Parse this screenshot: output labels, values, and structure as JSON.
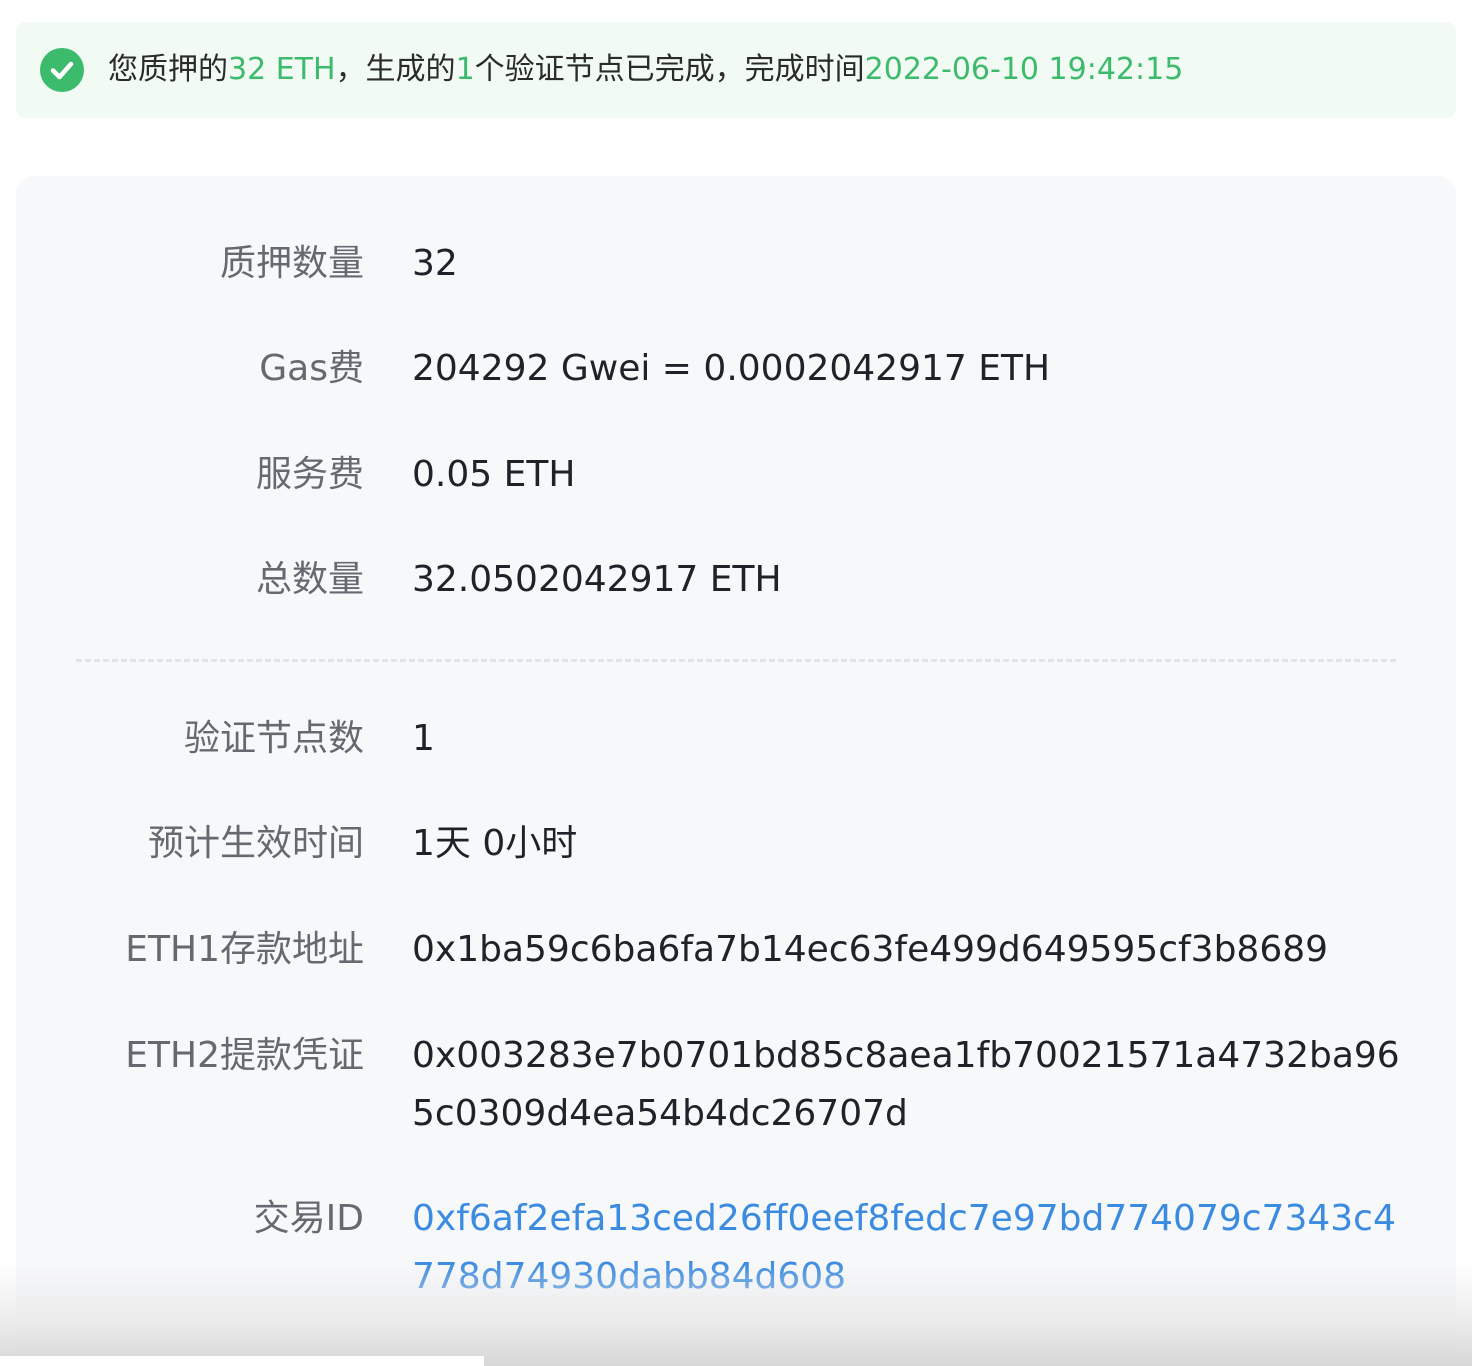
{
  "banner": {
    "icon": "check-circle-icon",
    "text_prefix": "您质押的",
    "amount": "32 ETH",
    "text_mid1": "，生成的",
    "node_count": "1",
    "text_mid2": "个验证节点已完成，完成时间",
    "completed_time": "2022-06-10 19:42:15"
  },
  "details": {
    "stake_amount": {
      "label": "质押数量",
      "value": "32"
    },
    "gas_fee": {
      "label": "Gas费",
      "value": "204292 Gwei = 0.0002042917 ETH"
    },
    "service_fee": {
      "label": "服务费",
      "value": "0.05 ETH"
    },
    "total": {
      "label": "总数量",
      "value": "32.0502042917 ETH"
    },
    "validator_count": {
      "label": "验证节点数",
      "value": "1"
    },
    "effective_time": {
      "label": "预计生效时间",
      "value": "1天 0小时"
    },
    "eth1_deposit_address": {
      "label": "ETH1存款地址",
      "value": "0x1ba59c6ba6fa7b14ec63fe499d649595cf3b8689"
    },
    "eth2_withdrawal_credentials": {
      "label": "ETH2提款凭证",
      "value": "0x003283e7b0701bd85c8aea1fb70021571a4732ba965c0309d4ea54b4dc26707d"
    },
    "transaction_id": {
      "label": "交易ID",
      "value": "0xf6af2efa13ced26ff0eef8fedc7e97bd774079c7343c4778d74930dabb84d608"
    }
  },
  "colors": {
    "accent_green": "#3dbb6c",
    "link_blue": "#3b8be0",
    "banner_bg": "#f2faf4",
    "card_bg": "#f7f8fa"
  }
}
